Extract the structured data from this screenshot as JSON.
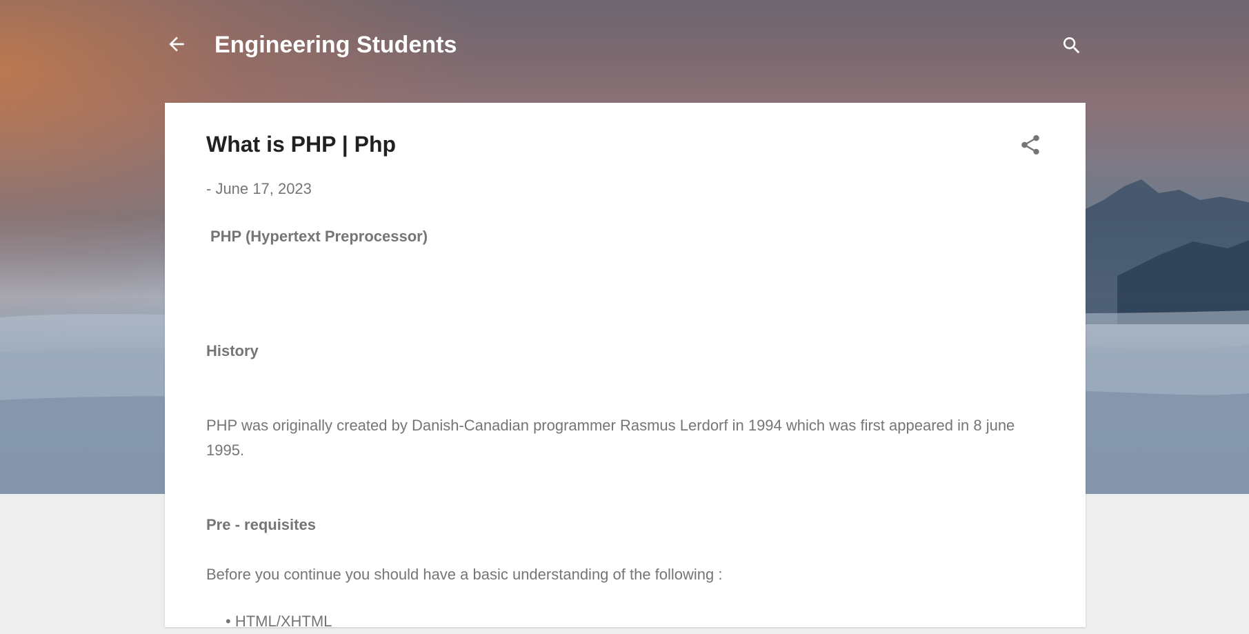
{
  "header": {
    "blog_title": "Engineering Students",
    "back_icon": "arrow-left-icon",
    "search_icon": "search-icon"
  },
  "post": {
    "title": "What is PHP | Php",
    "date": "- June 17, 2023",
    "share_icon": "share-icon",
    "subtitle": "PHP (Hypertext Preprocessor)",
    "history_heading": "History",
    "history_paragraph": "PHP  was originally created by Danish-Canadian programmer Rasmus Lerdorf in 1994 which was first appeared in 8 june 1995.",
    "prereq_heading": "Pre - requisites",
    "prereq_paragraph": "Before you continue you should have a basic understanding of the following :",
    "prereq_list": [
      "HTML/XHTML"
    ]
  },
  "colors": {
    "text_primary": "#212121",
    "text_secondary": "#757575",
    "page_background": "#eeeeee",
    "card_background": "#ffffff",
    "header_text": "#ffffff"
  }
}
